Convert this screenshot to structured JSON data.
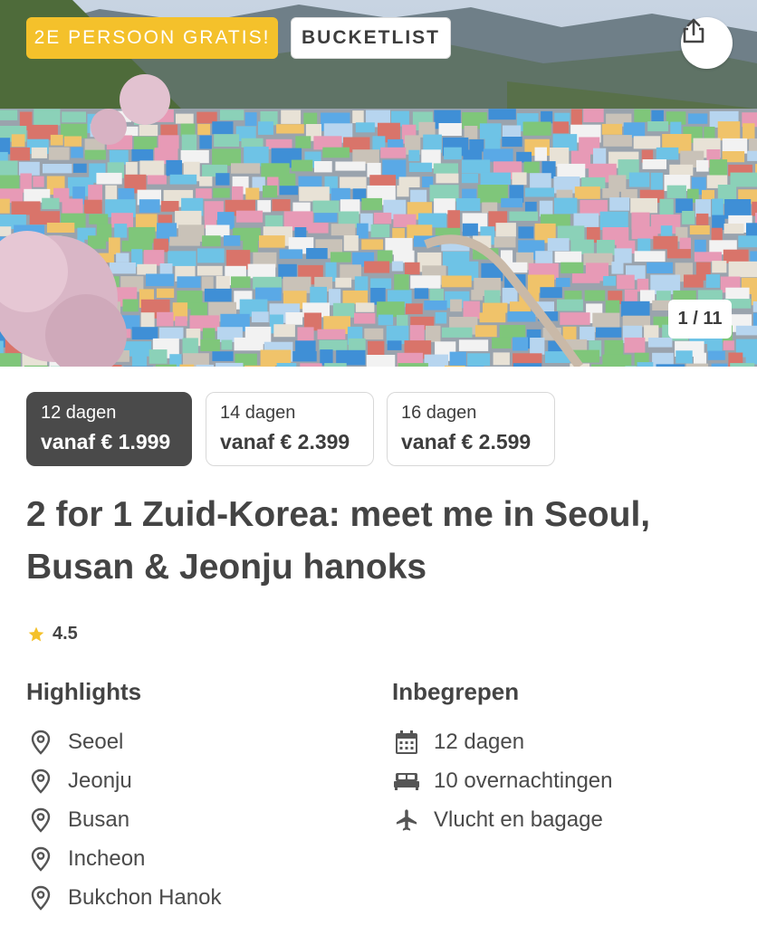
{
  "hero": {
    "badge_promo": "2E PERSOON GRATIS!",
    "badge_tag": "BUCKETLIST",
    "share_icon": "share-icon",
    "counter": "1 / 11"
  },
  "options": [
    {
      "days": "12 dagen",
      "price": "vanaf € 1.999",
      "selected": true
    },
    {
      "days": "14 dagen",
      "price": "vanaf € 2.399",
      "selected": false
    },
    {
      "days": "16 dagen",
      "price": "vanaf € 2.599",
      "selected": false
    }
  ],
  "title": "2 for 1 Zuid-Korea: meet me in Seoul, Busan & Jeonju hanoks",
  "rating": {
    "value": "4.5",
    "icon": "star-icon",
    "color": "#f4c12b"
  },
  "highlights": {
    "heading": "Highlights",
    "icon": "location-pin-icon",
    "items": [
      "Seoel",
      "Jeonju",
      "Busan",
      "Incheon",
      "Bukchon Hanok"
    ]
  },
  "included": {
    "heading": "Inbegrepen",
    "items": [
      {
        "icon": "calendar-icon",
        "label": "12 dagen"
      },
      {
        "icon": "bed-icon",
        "label": "10 overnachtingen"
      },
      {
        "icon": "airplane-icon",
        "label": "Vlucht en bagage"
      }
    ]
  },
  "colors": {
    "accent": "#f4c12b",
    "selected_option": "#4a4a4a",
    "text": "#3d3d3d"
  }
}
